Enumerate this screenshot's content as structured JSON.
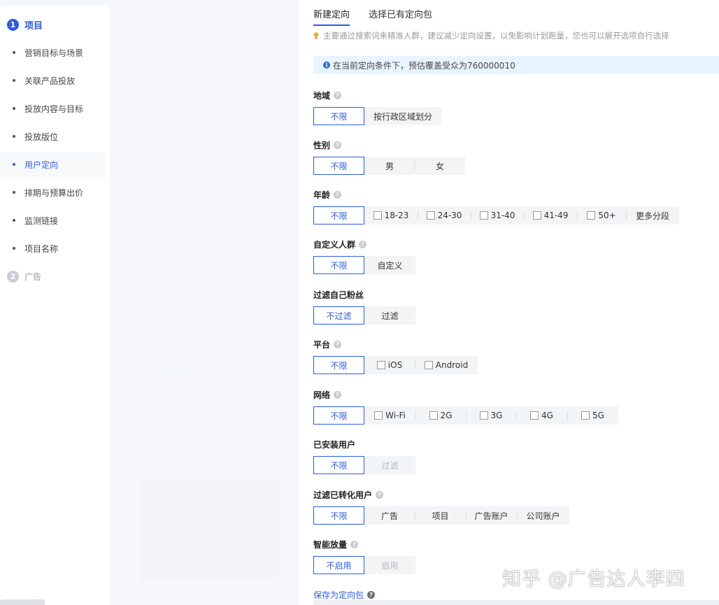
{
  "sidebar": {
    "step1": {
      "num": "1",
      "label": "项目"
    },
    "items": [
      {
        "label": "营销目标与场景"
      },
      {
        "label": "关联产品投放"
      },
      {
        "label": "投放内容与目标"
      },
      {
        "label": "投放版位"
      },
      {
        "label": "用户定向"
      },
      {
        "label": "排期与预算出价"
      },
      {
        "label": "监测链接"
      },
      {
        "label": "项目名称"
      }
    ],
    "active_item": "用户定向",
    "step2": {
      "num": "2",
      "label": "广告"
    }
  },
  "tabs": [
    {
      "label": "新建定向",
      "active": true
    },
    {
      "label": "选择已有定向包",
      "active": false
    }
  ],
  "hint": "主要通过搜索词来精准人群，建议减少定向设置，以免影响计划跑量，您也可以展开选项自行选择",
  "info": "在当前定向条件下，预估覆盖受众为760000010",
  "fields": {
    "region": {
      "label": "地域",
      "options": [
        "不限",
        "按行政区域划分"
      ]
    },
    "gender": {
      "label": "性别",
      "options": [
        "不限",
        "男",
        "女"
      ]
    },
    "age": {
      "label": "年龄",
      "options": [
        "不限",
        "18-23",
        "24-30",
        "31-40",
        "41-49",
        "50+",
        "更多分段"
      ]
    },
    "custom_audience": {
      "label": "自定义人群",
      "options": [
        "不限",
        "自定义"
      ]
    },
    "filter_fans": {
      "label": "过滤自己粉丝",
      "options": [
        "不过滤",
        "过滤"
      ]
    },
    "platform": {
      "label": "平台",
      "options": [
        "不限",
        "iOS",
        "Android"
      ]
    },
    "network": {
      "label": "网络",
      "options": [
        "不限",
        "Wi-Fi",
        "2G",
        "3G",
        "4G",
        "5G"
      ]
    },
    "installed": {
      "label": "已安装用户",
      "options": [
        "不限",
        "过滤"
      ]
    },
    "converted": {
      "label": "过滤已转化用户",
      "options": [
        "不限",
        "广告",
        "项目",
        "广告账户",
        "公司账户"
      ]
    },
    "smart": {
      "label": "智能放量",
      "options": [
        "不启用",
        "启用"
      ]
    }
  },
  "save_link": "保存为定向包",
  "watermark": "知乎 @广告达人李四",
  "colors": {
    "accent": "#2b5ce6",
    "info_bg": "#e8f4ff",
    "option_bg": "#f3f4f6"
  }
}
